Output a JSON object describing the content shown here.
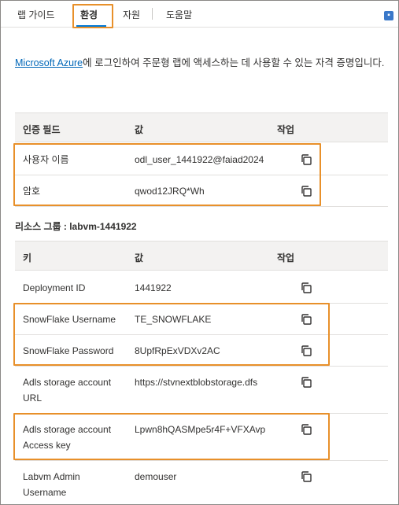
{
  "tabs": [
    {
      "label": "랩 가이드"
    },
    {
      "label": "환경"
    },
    {
      "label": "자원"
    },
    {
      "label": "도움말"
    }
  ],
  "intro": {
    "link_text": "Microsoft Azure",
    "text": "에 로그인하여 주문형 랩에 액세스하는 데 사용할 수 있는 자격 증명입니다."
  },
  "credentials": {
    "headers": {
      "field": "인증 필드",
      "value": "값",
      "action": "작업"
    },
    "rows": [
      {
        "field": "사용자 이름",
        "value": "odl_user_1441922@faiad2024"
      },
      {
        "field": "암호",
        "value": "qwod12JRQ*Wh"
      }
    ]
  },
  "resource_group": {
    "title": "리소스 그룹 : labvm-1441922",
    "headers": {
      "key": "키",
      "value": "값",
      "action": "작업"
    },
    "rows": [
      {
        "key": "Deployment ID",
        "value": "1441922"
      },
      {
        "key": "SnowFlake Username",
        "value": "TE_SNOWFLAKE"
      },
      {
        "key": "SnowFlake Password",
        "value": "8UpfRpExVDXv2AC"
      },
      {
        "key_line1": "Adls storage account",
        "key_line2": "URL",
        "value": "https://stvnextblobstorage.dfs"
      },
      {
        "key_line1": "Adls storage account",
        "key_line2": "Access key",
        "value": "Lpwn8hQASMpe5r4F+VFXAvp"
      },
      {
        "key_line1": "Labvm Admin",
        "key_line2": "Username",
        "value": "demouser"
      }
    ]
  },
  "colors": {
    "highlight": "#e8902a",
    "link": "#0067b8",
    "accent": "#0078d4"
  }
}
